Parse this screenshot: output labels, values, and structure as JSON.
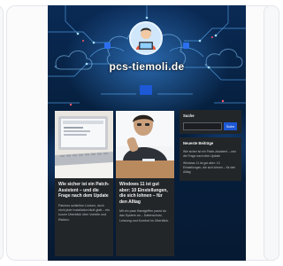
{
  "site": {
    "title": "pcs-tiemoli.de",
    "colors": {
      "accent": "#1d58d6",
      "background": "#071a33",
      "card": "#232629"
    }
  },
  "icons": {
    "avatar": "person-at-laptop-icon",
    "menu": "menu-toggle-icon"
  },
  "posts": [
    {
      "title": "Wie sicher ist ein Patch-Assistent – und die Frage nach dem Update",
      "excerpt": "Patches schließen Lücken, doch nicht jede Installation läuft glatt – ein kurzer Überblick über Vorteile und Risiken.",
      "image": "laptop-on-desk"
    },
    {
      "title": "Windows 11 ist gut aber: 10 Einstellungen, die sich lohnen – für den Alltag",
      "excerpt": "Mit ein paar Handgriffen passt du das System an – Datenschutz, Leistung und Komfort im Überblick.",
      "image": "child-at-table"
    }
  ],
  "sidebar": {
    "search": {
      "title": "Suche",
      "placeholder": "",
      "button": "Suche"
    },
    "recent": {
      "title": "Neueste Beiträge",
      "items": [
        "Wie sicher ist ein Patch-Assistent – und die Frage nach dem Update",
        "Windows 11 ist gut aber: 10 Einstellungen, die sich lohnen – für den Alltag"
      ]
    }
  }
}
